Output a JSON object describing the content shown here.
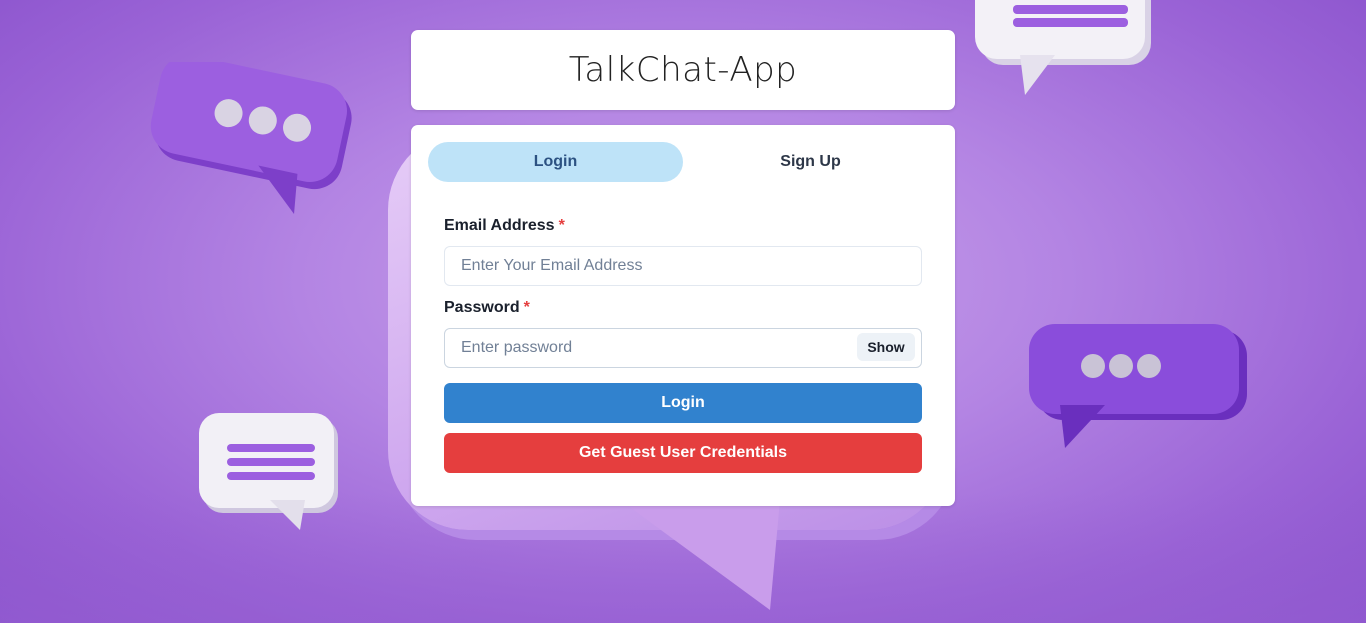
{
  "app": {
    "title": "TalkChat-App"
  },
  "tabs": [
    {
      "label": "Login",
      "active": true
    },
    {
      "label": "Sign Up",
      "active": false
    }
  ],
  "form": {
    "email": {
      "label": "Email Address",
      "required_mark": "*",
      "placeholder": "Enter Your Email Address",
      "value": ""
    },
    "password": {
      "label": "Password",
      "required_mark": "*",
      "placeholder": "Enter password",
      "value": "",
      "toggle_label": "Show"
    },
    "submit_label": "Login",
    "guest_label": "Get Guest User Credentials"
  },
  "colors": {
    "background": "#b384e3",
    "tab_active_bg": "#bee3f8",
    "primary_button": "#3182ce",
    "danger_button": "#e53e3e",
    "required_mark": "#e53e3e"
  },
  "icons": {
    "decor_bubble_dots": "chat-bubble-dots-icon",
    "decor_bubble_lines": "chat-bubble-lines-icon"
  }
}
